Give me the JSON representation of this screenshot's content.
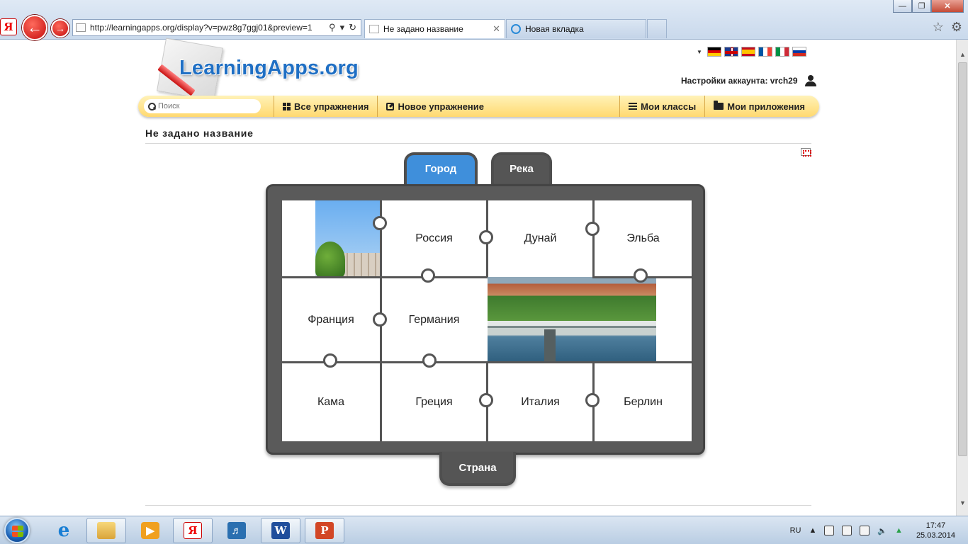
{
  "browser": {
    "url": "http://learningapps.org/display?v=pwz8g7ggj01&preview=1",
    "tabs": [
      {
        "label": "Не задано название"
      },
      {
        "label": "Новая вкладка"
      }
    ]
  },
  "site": {
    "logo_text": "LearningApps.org",
    "account_label": "Настройки аккаунта: vrch29",
    "languages": [
      "de",
      "gb",
      "es",
      "fr",
      "it",
      "ru"
    ],
    "search_placeholder": "Поиск",
    "nav": {
      "all_exercises": "Все упражнения",
      "new_exercise": "Новое упражнение",
      "my_classes": "Мои классы",
      "my_apps": "Мои приложения"
    }
  },
  "page": {
    "title": "Не задано название"
  },
  "puzzle": {
    "categories": {
      "city": "Город",
      "river": "Река",
      "country": "Страна"
    },
    "pieces": {
      "r1c2": "Россия",
      "r1c3": "Дунай",
      "r1c4": "Эльба",
      "r2c1": "Франция",
      "r2c2": "Германия",
      "r3c1": "Кама",
      "r3c2": "Греция",
      "r3c3": "Италия",
      "r3c4": "Берлин"
    }
  },
  "taskbar": {
    "language": "RU",
    "time": "17:47",
    "date": "25.03.2014"
  },
  "colors": {
    "accent_blue": "#3f8fdb",
    "nav_yellow": "#ffd970",
    "board_gray": "#5a5a5a"
  }
}
